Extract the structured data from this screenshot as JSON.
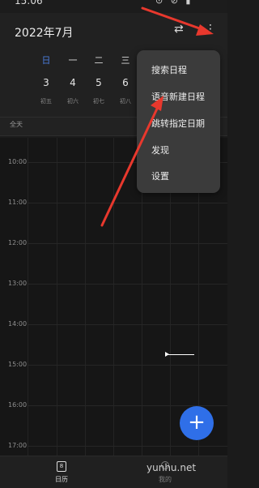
{
  "status_bar": {
    "time": "15:06",
    "icons_text": "⊙ ⊘ ▮"
  },
  "header": {
    "title": "2022年7月",
    "swap_icon": "swap-arrows-icon",
    "more_icon": "more-vertical-icon"
  },
  "week": {
    "days": [
      {
        "weekday": "日",
        "date": "3",
        "lunar": "初五",
        "selected": true
      },
      {
        "weekday": "一",
        "date": "4",
        "lunar": "初六",
        "selected": false
      },
      {
        "weekday": "二",
        "date": "5",
        "lunar": "初七",
        "selected": false
      },
      {
        "weekday": "三",
        "date": "6",
        "lunar": "初八",
        "selected": false
      }
    ]
  },
  "all_day_label": "全天",
  "hours": [
    "10:00",
    "11:00",
    "12:00",
    "13:00",
    "14:00",
    "15:00",
    "16:00",
    "17:00"
  ],
  "menu": {
    "items": [
      "搜索日程",
      "语音新建日程",
      "跳转指定日期",
      "发现",
      "设置"
    ]
  },
  "fab": {
    "label": "+"
  },
  "bottom_nav": {
    "calendar_icon_text": "8",
    "calendar_label": "日历",
    "me_label": "我的"
  },
  "watermark": "yunhu.net",
  "colors": {
    "accent": "#2f6fe8",
    "selected_weekday": "#4a7bd8",
    "annotation_arrow": "#e8382d",
    "menu_bg": "#3b3b3b"
  }
}
